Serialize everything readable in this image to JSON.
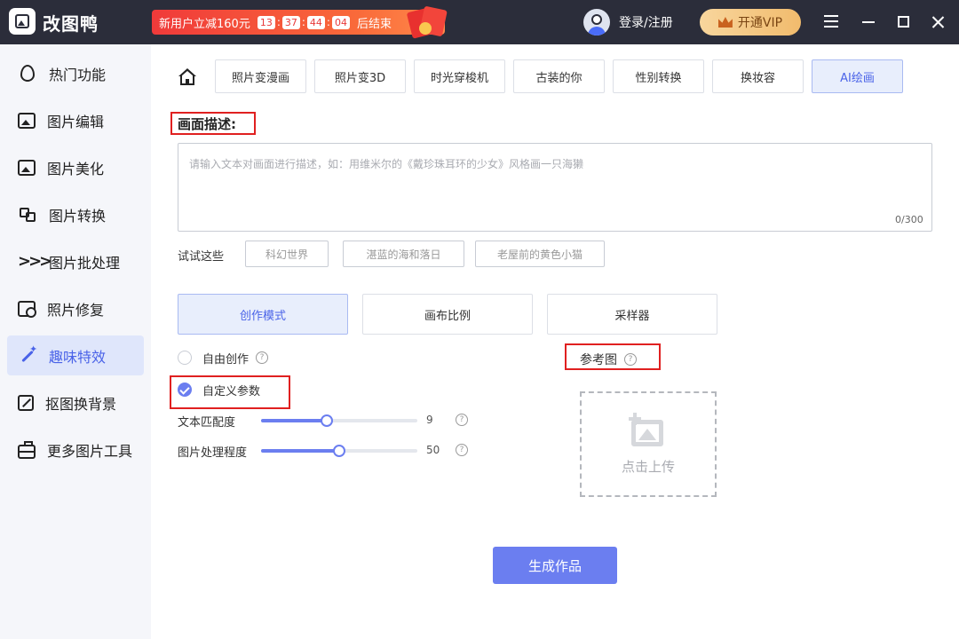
{
  "app": {
    "name": "改图鸭"
  },
  "promo": {
    "text": "新用户立减160元",
    "countdown": [
      "13",
      "37",
      "44",
      "04"
    ],
    "suffix": "后结束"
  },
  "header": {
    "login_label": "登录/注册",
    "vip_label": "开通VIP"
  },
  "sidebar": {
    "items": [
      {
        "label": "热门功能",
        "icon": "flame-icon"
      },
      {
        "label": "图片编辑",
        "icon": "image-edit-icon"
      },
      {
        "label": "图片美化",
        "icon": "image-beautify-icon"
      },
      {
        "label": "图片转换",
        "icon": "convert-icon"
      },
      {
        "label": "图片批处理",
        "icon": "batch-icon"
      },
      {
        "label": "照片修复",
        "icon": "repair-icon"
      },
      {
        "label": "趣味特效",
        "icon": "magic-wand-icon",
        "active": true
      },
      {
        "label": "抠图换背景",
        "icon": "cutout-icon"
      },
      {
        "label": "更多图片工具",
        "icon": "toolbox-icon"
      }
    ]
  },
  "tabs": [
    {
      "label": "照片变漫画"
    },
    {
      "label": "照片变3D"
    },
    {
      "label": "时光穿梭机"
    },
    {
      "label": "古装的你"
    },
    {
      "label": "性别转换"
    },
    {
      "label": "换妆容"
    },
    {
      "label": "AI绘画",
      "active": true
    }
  ],
  "description": {
    "title": "画面描述:",
    "placeholder": "请输入文本对画面进行描述，如：用维米尔的《戴珍珠耳环的少女》风格画一只海獭",
    "value": "",
    "counter": "0/300"
  },
  "suggestions": {
    "label": "试试这些",
    "chips": [
      "科幻世界",
      "湛蓝的海和落日",
      "老屋前的黄色小猫"
    ]
  },
  "settings_tabs": [
    {
      "label": "创作模式",
      "active": true
    },
    {
      "label": "画布比例"
    },
    {
      "label": "采样器"
    }
  ],
  "mode": {
    "free_label": "自由创作",
    "custom_label": "自定义参数",
    "selected": "custom"
  },
  "sliders": [
    {
      "label": "文本匹配度",
      "value": "9",
      "fraction": 0.42
    },
    {
      "label": "图片处理程度",
      "value": "50",
      "fraction": 0.5
    }
  ],
  "reference": {
    "label": "参考图",
    "upload_label": "点击上传"
  },
  "generate_label": "生成作品",
  "help_glyph": "?",
  "colors": {
    "accent": "#6b7ef0",
    "highlight_box": "#e02020",
    "titlebar": "#2b2d3a"
  }
}
